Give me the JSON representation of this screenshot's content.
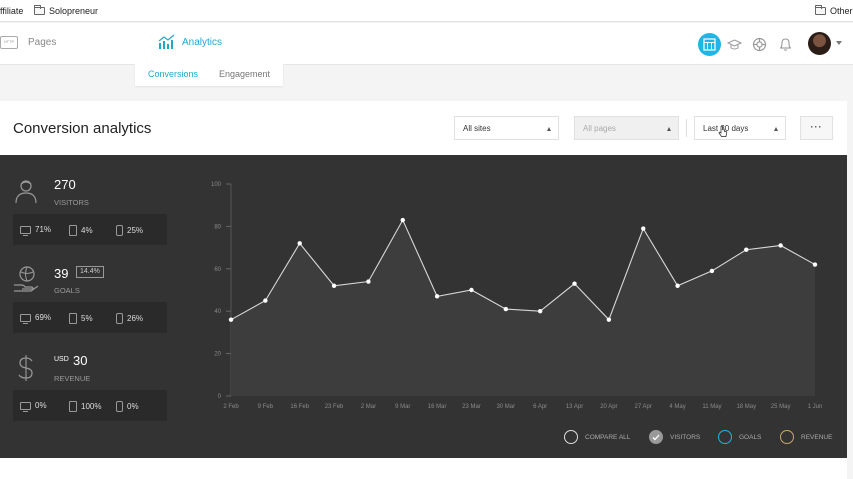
{
  "bookmarks": {
    "affiliate": "ffiliate",
    "solopreneur": "Solopreneur",
    "other": "Other"
  },
  "nav": {
    "pages": "Pages",
    "analytics": "Analytics"
  },
  "tabs": {
    "conversions": "Conversions",
    "engagement": "Engagement"
  },
  "header": {
    "title": "Conversion analytics",
    "site_filter": "All sites",
    "page_filter": "All pages",
    "date_filter": "Last 30 days",
    "more": "···"
  },
  "metrics": {
    "visitors": {
      "value": "270",
      "label": "VISITORS",
      "desktop": "71%",
      "tablet": "4%",
      "mobile": "25%"
    },
    "goals": {
      "value": "39",
      "badge": "14.4%",
      "label": "GOALS",
      "desktop": "69%",
      "tablet": "5%",
      "mobile": "26%"
    },
    "revenue": {
      "currency": "USD",
      "value": "30",
      "label": "REVENUE",
      "desktop": "0%",
      "tablet": "100%",
      "mobile": "0%"
    }
  },
  "legend": {
    "compare_all": "COMPARE ALL",
    "visitors": "VISITORS",
    "goals": "GOALS",
    "revenue": "REVENUE"
  },
  "colors": {
    "accent": "#22a9c9",
    "panel": "#333333",
    "goals": "#1fb6e6",
    "revenue": "#c8a86a"
  },
  "chart_data": {
    "type": "area",
    "x": [
      "2 Feb",
      "9 Feb",
      "16 Feb",
      "23 Feb",
      "2 Mar",
      "9 Mar",
      "16 Mar",
      "23 Mar",
      "30 Mar",
      "6 Apr",
      "13 Apr",
      "20 Apr",
      "27 Apr",
      "4 May",
      "11 May",
      "18 May",
      "25 May",
      "1 Jun"
    ],
    "y_ticks": [
      "0",
      "20",
      "40",
      "60",
      "80",
      "100"
    ],
    "ylim": [
      0,
      100
    ],
    "series": [
      {
        "name": "VISITORS",
        "values": [
          36,
          45,
          72,
          52,
          54,
          83,
          47,
          50,
          41,
          40,
          53,
          36,
          79,
          52,
          59,
          69,
          71,
          62
        ]
      }
    ],
    "grid": false
  }
}
